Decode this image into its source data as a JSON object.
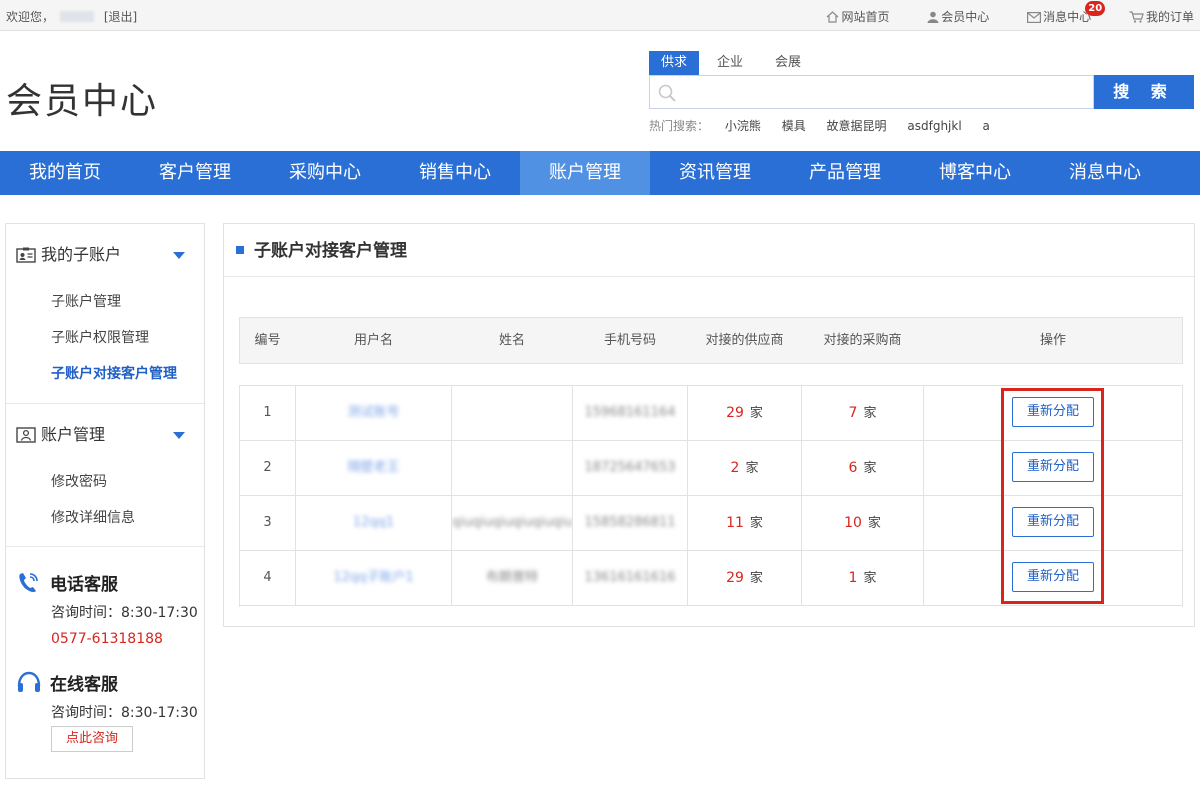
{
  "topbar": {
    "welcome": "欢迎您，",
    "logout": "[退出]",
    "links": [
      {
        "label": "网站首页",
        "icon": "home-icon"
      },
      {
        "label": "会员中心",
        "icon": "user-icon"
      },
      {
        "label": "消息中心",
        "icon": "mail-icon",
        "badge": "20"
      },
      {
        "label": "我的订单",
        "icon": "cart-icon"
      }
    ]
  },
  "header": {
    "title": "会员中心",
    "search": {
      "tabs": [
        "供求",
        "企业",
        "会展"
      ],
      "active_tab": "供求",
      "placeholder": "",
      "button": "搜 索",
      "hot_label": "热门搜索：",
      "hot_keywords": [
        "小浣熊",
        "模具",
        "故意据昆明",
        "asdfghjkl",
        "a"
      ]
    }
  },
  "nav": {
    "items": [
      "我的首页",
      "客户管理",
      "采购中心",
      "销售中心",
      "账户管理",
      "资讯管理",
      "产品管理",
      "博客中心",
      "消息中心"
    ],
    "active": "账户管理"
  },
  "sidebar": {
    "group1": {
      "title": "我的子账户",
      "items": [
        "子账户管理",
        "子账户权限管理",
        "子账户对接客户管理"
      ],
      "active": "子账户对接客户管理"
    },
    "group2": {
      "title": "账户管理",
      "items": [
        "修改密码",
        "修改详细信息"
      ]
    },
    "phone_service": {
      "title": "电话客服",
      "hours": "咨询时间：8:30-17:30",
      "phone": "0577-61318188"
    },
    "online_service": {
      "title": "在线客服",
      "hours": "咨询时间：8:30-17:30",
      "button": "点此咨询"
    }
  },
  "main": {
    "title": "子账户对接客户管理",
    "columns": [
      "编号",
      "用户名",
      "姓名",
      "手机号码",
      "对接的供应商",
      "对接的采购商",
      "操作"
    ],
    "unit": "家",
    "action_label": "重新分配",
    "rows": [
      {
        "id": "1",
        "username": "测试账号",
        "name": "",
        "phone": "15968161164",
        "suppliers": "29",
        "buyers": "7"
      },
      {
        "id": "2",
        "username": "隔壁老王",
        "name": "",
        "phone": "18725647653",
        "suppliers": "2",
        "buyers": "6"
      },
      {
        "id": "3",
        "username": "12qq1",
        "name": "qiuqiuqiuqiuqiuqiu",
        "phone": "15858286811",
        "suppliers": "11",
        "buyers": "10"
      },
      {
        "id": "4",
        "username": "12qq子账户1",
        "name": "布朗普特",
        "phone": "13616161616",
        "suppliers": "29",
        "buyers": "1"
      }
    ]
  },
  "colors": {
    "primary": "#2a6fd6",
    "nav_active": "#5191e3",
    "accent_red": "#d9251d"
  }
}
